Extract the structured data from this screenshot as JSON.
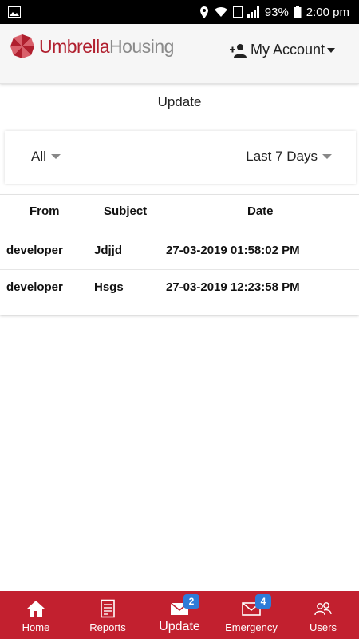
{
  "status": {
    "battery": "93%",
    "time": "2:00 pm"
  },
  "header": {
    "logo_word1": "Umbrella",
    "logo_word2": "Housing",
    "account_label": "My Account"
  },
  "page": {
    "title": "Update"
  },
  "filters": {
    "type": "All",
    "range": "Last 7 Days"
  },
  "table": {
    "columns": [
      "From",
      "Subject",
      "Date"
    ],
    "rows": [
      {
        "from": "developer",
        "subject": "Jdjjd",
        "date": "27-03-2019 01:58:02 PM"
      },
      {
        "from": "developer",
        "subject": "Hsgs",
        "date": "27-03-2019 12:23:58 PM"
      }
    ]
  },
  "nav": {
    "items": [
      {
        "label": "Home",
        "icon": "home-icon"
      },
      {
        "label": "Reports",
        "icon": "reports-icon"
      },
      {
        "label": "Update",
        "icon": "mail-icon",
        "badge": "2"
      },
      {
        "label": "Emergency",
        "icon": "mail-icon",
        "badge": "4"
      },
      {
        "label": "Users",
        "icon": "users-icon"
      }
    ]
  },
  "colors": {
    "brand": "#c2202f",
    "badge": "#2f7bd8"
  }
}
